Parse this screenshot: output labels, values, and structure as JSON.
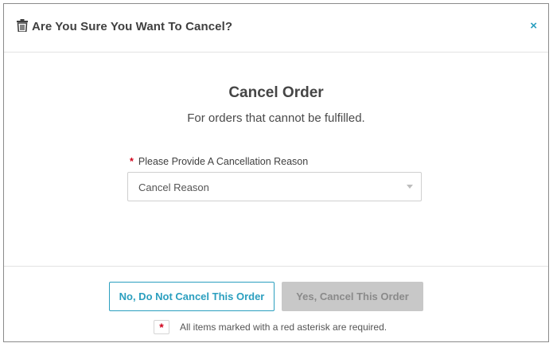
{
  "dialog": {
    "title": "Are You Sure You Want To Cancel?",
    "header_icon": "trash-icon",
    "close_label": "×"
  },
  "body": {
    "title": "Cancel Order",
    "subtitle": "For orders that cannot be fulfilled.",
    "field": {
      "required_marker": "*",
      "label": "Please Provide A Cancellation Reason",
      "select_value": "Cancel Reason"
    }
  },
  "footer": {
    "no_button_label": "No, Do Not Cancel This Order",
    "yes_button_label": "Yes, Cancel This Order",
    "required_marker": "*",
    "required_note": "All items marked with a red asterisk are required."
  },
  "colors": {
    "accent": "#2b9fbf",
    "required": "#d0021b",
    "disabled_button": "#c8c8c8"
  }
}
